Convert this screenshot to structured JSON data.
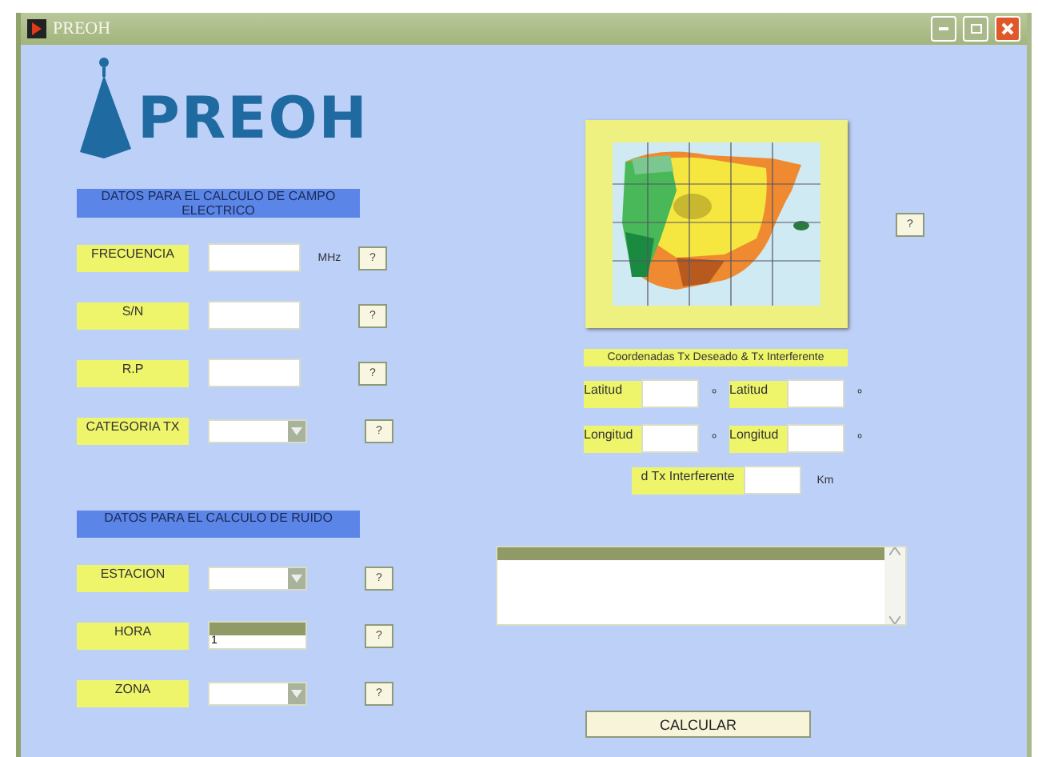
{
  "window": {
    "title": "PREOH"
  },
  "logo": {
    "text": "PREOH"
  },
  "sections": [
    {
      "heading": "DATOS PARA EL CALCULO DE CAMPO ELECTRICO",
      "rows": [
        {
          "kind": "text",
          "label": "FRECUENCIA",
          "unit": "MHz",
          "help": "?"
        },
        {
          "kind": "text",
          "label": "S/N",
          "help": "?"
        },
        {
          "kind": "text",
          "label": "R.P",
          "help": "?"
        },
        {
          "kind": "dropdown",
          "label": "CATEGORIA TX",
          "help": "?"
        }
      ]
    },
    {
      "heading": "DATOS PARA EL CALCULO DE RUIDO",
      "rows": [
        {
          "kind": "dropdown",
          "label": "ESTACION",
          "help": "?"
        },
        {
          "kind": "spinner",
          "label": "HORA",
          "value": "1",
          "help": "?"
        },
        {
          "kind": "dropdown",
          "label": "ZONA",
          "help": "?"
        }
      ]
    }
  ],
  "map": {
    "kind": "picture",
    "help": "?"
  },
  "coordinates": {
    "heading": "Coordenadas Tx Deseado & Tx Interferente",
    "rows": [
      [
        {
          "label": "Latitud",
          "unit": "º"
        },
        {
          "label": "Latitud",
          "unit": "º"
        }
      ],
      [
        {
          "label": "Longitud",
          "unit": "º"
        },
        {
          "label": "Longitud",
          "unit": "º"
        }
      ]
    ],
    "distance": {
      "label": "d Tx Interferente",
      "unit": "Km"
    }
  },
  "calculate_button": "CALCULAR"
}
